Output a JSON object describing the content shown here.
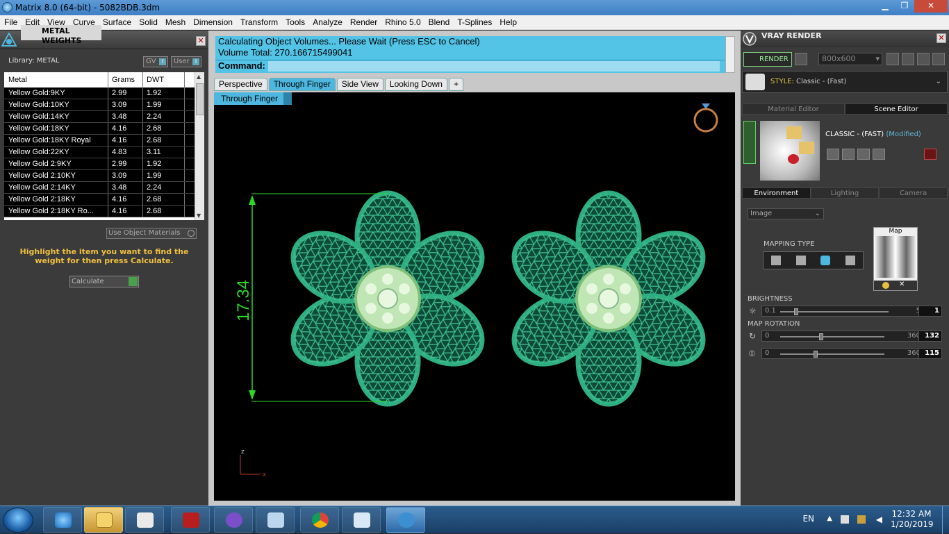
{
  "window": {
    "title": "Matrix 8.0 (64-bit) - 5082BDB.3dm",
    "minimize": "▁",
    "maximize": "❐",
    "close": "✕"
  },
  "menu": [
    "File",
    "Edit",
    "View",
    "Curve",
    "Surface",
    "Solid",
    "Mesh",
    "Dimension",
    "Transform",
    "Tools",
    "Analyze",
    "Render",
    "Rhino 5.0",
    "Blend",
    "T-Splines",
    "Help"
  ],
  "metal_panel": {
    "title": "METAL WEIGHTS",
    "library": "Library: METAL",
    "gv": "GV",
    "user": "User",
    "columns": [
      "Metal",
      "Grams",
      "DWT"
    ],
    "rows": [
      [
        "Yellow Gold:9KY",
        "2.99",
        "1.92"
      ],
      [
        "Yellow Gold:10KY",
        "3.09",
        "1.99"
      ],
      [
        "Yellow Gold:14KY",
        "3.48",
        "2.24"
      ],
      [
        "Yellow Gold:18KY",
        "4.16",
        "2.68"
      ],
      [
        "Yellow Gold:18KY Royal",
        "4.16",
        "2.68"
      ],
      [
        "Yellow Gold:22KY",
        "4.83",
        "3.11"
      ],
      [
        "Yellow Gold 2:9KY",
        "2.99",
        "1.92"
      ],
      [
        "Yellow Gold 2:10KY",
        "3.09",
        "1.99"
      ],
      [
        "Yellow Gold 2:14KY",
        "3.48",
        "2.24"
      ],
      [
        "Yellow Gold 2:18KY",
        "4.16",
        "2.68"
      ],
      [
        "Yellow Gold 2:18KY Ro...",
        "4.16",
        "2.68"
      ]
    ],
    "use_object_materials": "Use Object Materials",
    "hint": "Highlight the item you want to find the weight for then press Calculate.",
    "calculate": "Calculate"
  },
  "command": {
    "line1": "Calculating Object Volumes... Please Wait (Press ESC to Cancel)",
    "line2": "Volume Total: 270.166715499041",
    "prompt": "Command:"
  },
  "viewport_tabs": [
    "Perspective",
    "Through Finger",
    "Side View",
    "Looking Down",
    "+"
  ],
  "active_tab": 1,
  "viewport": {
    "label": "Through Finger",
    "dimension": "17.34",
    "axis_z": "z",
    "axis_x": "x"
  },
  "vray": {
    "title": "VRAY RENDER",
    "render": "RENDER",
    "resolution": "800x600",
    "style_label": "STYLE:",
    "style_value": "Classic - (Fast)",
    "tabs1": [
      "Material Editor",
      "Scene Editor"
    ],
    "scene_name": "CLASSIC - (FAST)",
    "scene_mod": "(Modified)",
    "tabs2": [
      "Environment",
      "Lighting",
      "Camera"
    ],
    "env_select": "Image",
    "map_label": "Map",
    "mapping_type": "MAPPING TYPE",
    "brightness": {
      "label": "BRIGHTNESS",
      "min": "0.1",
      "max": "5",
      "value": "1",
      "frac": 0.13
    },
    "map_rotation": "MAP ROTATION",
    "rot1": {
      "min": "0",
      "max": "360",
      "value": "132",
      "frac": 0.37
    },
    "rot2": {
      "min": "0",
      "max": "360",
      "value": "115",
      "frac": 0.32
    }
  },
  "taskbar": {
    "lang": "EN",
    "time": "12:32 AM",
    "date": "1/20/2019"
  },
  "colors": {
    "jewel": "#1f8a65",
    "dim": "#2bd62b",
    "cmd": "#53c3e6"
  }
}
